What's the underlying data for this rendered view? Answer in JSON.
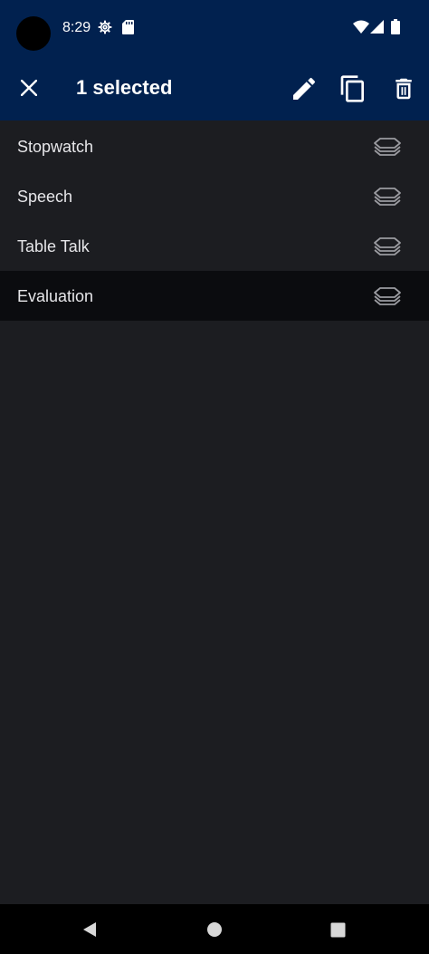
{
  "status_bar": {
    "time": "8:29",
    "icons": [
      "settings-gear-icon",
      "sd-card-icon",
      "wifi-icon",
      "cell-signal-icon",
      "battery-icon"
    ]
  },
  "action_bar": {
    "title": "1 selected",
    "actions": [
      "close-icon",
      "edit-pencil-icon",
      "copy-icon",
      "delete-trash-icon"
    ]
  },
  "list": {
    "items": [
      {
        "label": "Stopwatch",
        "selected": false
      },
      {
        "label": "Speech",
        "selected": false
      },
      {
        "label": "Table Talk",
        "selected": false
      },
      {
        "label": "Evaluation",
        "selected": true
      }
    ],
    "handle_icon": "drag-handle-icon"
  },
  "nav_bar": {
    "buttons": [
      "back-triangle-icon",
      "home-circle-icon",
      "recents-square-icon"
    ]
  },
  "colors": {
    "app_bar": "#01214f",
    "background": "#1c1d21",
    "selected_row": "#0b0c0f",
    "text": "#e6e6e9",
    "icon_white": "#ffffff",
    "handle_gray": "#9a9ba0"
  }
}
